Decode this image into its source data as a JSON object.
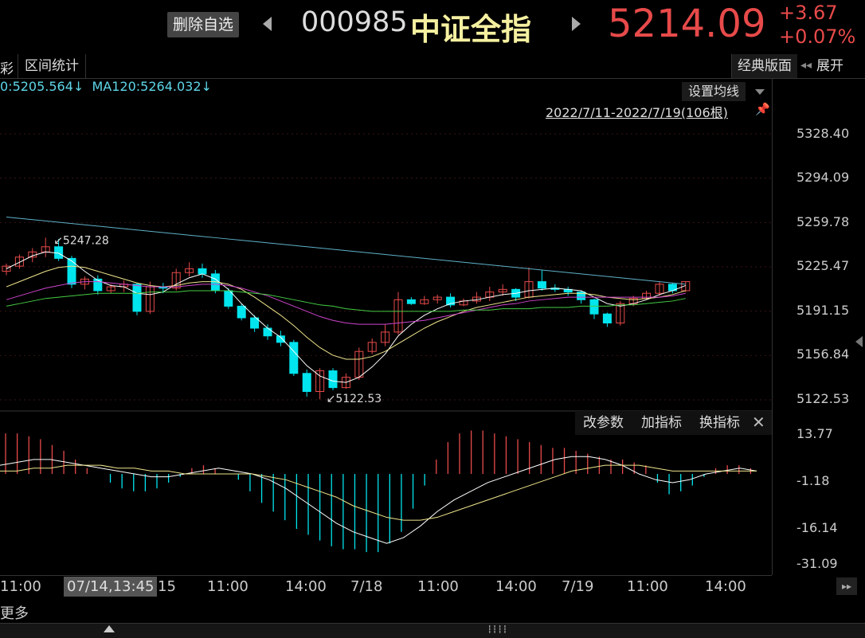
{
  "header": {
    "remove_label": "删除自选",
    "code": "000985",
    "name": "中证全指",
    "price": "5214.09",
    "change_abs": "+3.67",
    "change_pct": "+0.07%"
  },
  "toolbar": {
    "left_fragment": "彩",
    "interval_label": "区间统计",
    "classic_label": "经典版面",
    "expand_label": "展开"
  },
  "legend": {
    "ma_text": "0:5205.564↓  MA120:5264.032↓",
    "set_ma_label": "设置均线",
    "range_text": "2022/7/11-2022/7/19(106根)"
  },
  "y_axis_main": [
    "5328.40",
    "5294.09",
    "5259.78",
    "5225.47",
    "5191.15",
    "5156.84",
    "5122.53"
  ],
  "y_axis_sub": [
    "13.77",
    "-1.18",
    "-16.14",
    "-31.09"
  ],
  "annotations": {
    "high": "5247.28",
    "low": "5122.53"
  },
  "indicator_bar": {
    "modify": "改参数",
    "add": "加指标",
    "switch": "换指标",
    "close": "✕"
  },
  "x_axis": {
    "labels": [
      "11:00",
      "15",
      "11:00",
      "14:00",
      "7/18",
      "11:00",
      "14:00",
      "7/19",
      "11:00",
      "14:00"
    ],
    "highlight": "07/14,13:45",
    "scroll_glyph": "▸▸"
  },
  "bottom": {
    "more_label": "更多",
    "grip": "┇┇┇┇"
  },
  "colors": {
    "up": "#e84a4a",
    "down": "#00e5ee",
    "ma1": "#ffffff",
    "ma2": "#f0e68c",
    "ma3": "#cc44cc",
    "ma4": "#44cc44",
    "ma5": "#5fb0c8"
  },
  "chart_data": {
    "type": "candlestick",
    "ylim": [
      5122.53,
      5328.4
    ],
    "candles": [
      [
        5222,
        5228,
        5226,
        5219
      ],
      [
        5226,
        5235,
        5233,
        5224
      ],
      [
        5233,
        5240,
        5237,
        5229
      ],
      [
        5237,
        5248,
        5241,
        5233
      ],
      [
        5241,
        5247,
        5232,
        5230
      ],
      [
        5232,
        5234,
        5212,
        5209
      ],
      [
        5212,
        5218,
        5216,
        5208
      ],
      [
        5216,
        5219,
        5207,
        5204
      ],
      [
        5207,
        5212,
        5210,
        5205
      ],
      [
        5210,
        5215,
        5212,
        5206
      ],
      [
        5212,
        5213,
        5191,
        5188
      ],
      [
        5191,
        5214,
        5210,
        5189
      ],
      [
        5210,
        5213,
        5209,
        5205
      ],
      [
        5209,
        5224,
        5221,
        5207
      ],
      [
        5221,
        5229,
        5224,
        5218
      ],
      [
        5224,
        5228,
        5220,
        5217
      ],
      [
        5220,
        5223,
        5207,
        5205
      ],
      [
        5207,
        5209,
        5195,
        5193
      ],
      [
        5195,
        5197,
        5186,
        5184
      ],
      [
        5186,
        5188,
        5178,
        5175
      ],
      [
        5178,
        5181,
        5172,
        5169
      ],
      [
        5172,
        5176,
        5167,
        5164
      ],
      [
        5167,
        5169,
        5143,
        5141
      ],
      [
        5143,
        5146,
        5129,
        5125
      ],
      [
        5129,
        5147,
        5145,
        5123
      ],
      [
        5145,
        5147,
        5132,
        5130
      ],
      [
        5132,
        5143,
        5140,
        5131
      ],
      [
        5140,
        5163,
        5160,
        5138
      ],
      [
        5160,
        5170,
        5167,
        5158
      ],
      [
        5167,
        5181,
        5175,
        5164
      ],
      [
        5175,
        5206,
        5200,
        5173
      ],
      [
        5200,
        5202,
        5197,
        5196
      ],
      [
        5197,
        5203,
        5200,
        5196
      ],
      [
        5200,
        5204,
        5202,
        5197
      ],
      [
        5202,
        5205,
        5196,
        5194
      ],
      [
        5196,
        5201,
        5199,
        5195
      ],
      [
        5199,
        5206,
        5202,
        5197
      ],
      [
        5202,
        5210,
        5206,
        5199
      ],
      [
        5206,
        5212,
        5208,
        5203
      ],
      [
        5208,
        5209,
        5202,
        5199
      ],
      [
        5202,
        5225,
        5214,
        5201
      ],
      [
        5214,
        5223,
        5209,
        5207
      ],
      [
        5209,
        5212,
        5208,
        5206
      ],
      [
        5208,
        5210,
        5206,
        5203
      ],
      [
        5206,
        5207,
        5200,
        5197
      ],
      [
        5200,
        5201,
        5189,
        5185
      ],
      [
        5189,
        5190,
        5182,
        5179
      ],
      [
        5182,
        5199,
        5197,
        5180
      ],
      [
        5197,
        5203,
        5201,
        5195
      ],
      [
        5201,
        5207,
        5205,
        5200
      ],
      [
        5205,
        5214,
        5212,
        5203
      ],
      [
        5212,
        5213,
        5207,
        5205
      ],
      [
        5207,
        5214,
        5214,
        5206
      ]
    ],
    "ma_lines": {
      "ma1": [
        5224,
        5229,
        5234,
        5237,
        5236,
        5230,
        5222,
        5215,
        5211,
        5210,
        5205,
        5204,
        5206,
        5212,
        5217,
        5220,
        5216,
        5208,
        5197,
        5187,
        5178,
        5171,
        5160,
        5149,
        5141,
        5137,
        5136,
        5140,
        5148,
        5158,
        5172,
        5181,
        5188,
        5193,
        5197,
        5199,
        5200,
        5202,
        5204,
        5205,
        5207,
        5208,
        5209,
        5208,
        5207,
        5202,
        5197,
        5195,
        5197,
        5200,
        5204,
        5207,
        5211
      ],
      "ma2": [
        5210,
        5214,
        5218,
        5222,
        5225,
        5226,
        5225,
        5222,
        5219,
        5216,
        5213,
        5211,
        5210,
        5211,
        5213,
        5214,
        5214,
        5212,
        5208,
        5202,
        5195,
        5188,
        5180,
        5171,
        5163,
        5157,
        5154,
        5154,
        5156,
        5160,
        5166,
        5172,
        5178,
        5183,
        5187,
        5191,
        5194,
        5196,
        5198,
        5200,
        5202,
        5203,
        5204,
        5205,
        5205,
        5204,
        5202,
        5201,
        5200,
        5201,
        5202,
        5204,
        5207
      ],
      "ma3": [
        5200,
        5203,
        5206,
        5209,
        5211,
        5213,
        5214,
        5214,
        5213,
        5212,
        5211,
        5210,
        5210,
        5210,
        5211,
        5212,
        5212,
        5211,
        5209,
        5206,
        5203,
        5199,
        5195,
        5191,
        5187,
        5184,
        5182,
        5181,
        5181,
        5181,
        5182,
        5183,
        5184,
        5186,
        5188,
        5190,
        5192,
        5194,
        5196,
        5197,
        5199,
        5200,
        5201,
        5202,
        5202,
        5202,
        5202,
        5202,
        5202,
        5202,
        5202,
        5203,
        5205
      ],
      "ma4": [
        5195,
        5197,
        5199,
        5201,
        5202,
        5203,
        5204,
        5205,
        5205,
        5205,
        5205,
        5206,
        5206,
        5206,
        5207,
        5207,
        5207,
        5207,
        5206,
        5205,
        5204,
        5202,
        5200,
        5198,
        5196,
        5195,
        5193,
        5192,
        5191,
        5191,
        5191,
        5191,
        5191,
        5191,
        5191,
        5192,
        5192,
        5192,
        5193,
        5193,
        5193,
        5194,
        5194,
        5194,
        5195,
        5195,
        5195,
        5196,
        5196,
        5197,
        5198,
        5199,
        5201
      ],
      "ma5": [
        5264,
        5263,
        5262,
        5261,
        5260,
        5259,
        5258,
        5257,
        5256,
        5255,
        5254,
        5253,
        5252,
        5251,
        5250,
        5249,
        5248,
        5247,
        5246,
        5245,
        5244,
        5243,
        5242,
        5241,
        5240,
        5239,
        5238,
        5237,
        5236,
        5235,
        5234,
        5233,
        5232,
        5231,
        5230,
        5229,
        5228,
        5227,
        5226,
        5225,
        5224,
        5223,
        5222,
        5221,
        5220,
        5219,
        5218,
        5217,
        5216,
        5215,
        5214,
        5213,
        5212
      ]
    },
    "macd": {
      "ylim": [
        -31.09,
        13.77
      ],
      "hist": [
        14,
        14,
        13,
        12,
        10,
        8,
        5,
        2,
        0,
        -3,
        -5,
        -6,
        -6,
        -5,
        -3,
        -1,
        2,
        3,
        2,
        0,
        -2,
        -6,
        -10,
        -13,
        -16,
        -19,
        -21,
        -23,
        -25,
        -26,
        -26,
        -27,
        -27,
        -24,
        -20,
        -12,
        -4,
        5,
        11,
        14,
        15,
        15,
        14,
        13,
        12,
        11,
        10,
        9,
        9,
        8,
        7,
        6,
        5,
        5,
        4,
        3,
        -3,
        -7,
        -6,
        -4,
        -1,
        2,
        3,
        3,
        2
      ],
      "dif": [
        3,
        4,
        5,
        5,
        4,
        3,
        2,
        1,
        0,
        -1,
        -1,
        0,
        1,
        2,
        1,
        0,
        -2,
        -5,
        -9,
        -13,
        -17,
        -20,
        -22,
        -24,
        -22,
        -18,
        -13,
        -9,
        -6,
        -3,
        -1,
        1,
        3,
        5,
        6,
        6,
        5,
        3,
        0,
        -2,
        -3,
        -2,
        0,
        1,
        2,
        1
      ],
      "dea": [
        1,
        1,
        2,
        2,
        3,
        3,
        3,
        2,
        2,
        1,
        1,
        0,
        0,
        0,
        0,
        0,
        -1,
        -2,
        -4,
        -6,
        -8,
        -11,
        -13,
        -15,
        -16,
        -16,
        -15,
        -13,
        -11,
        -9,
        -7,
        -5,
        -3,
        -1,
        1,
        2,
        3,
        3,
        3,
        2,
        1,
        1,
        1,
        1,
        1,
        1
      ]
    }
  }
}
